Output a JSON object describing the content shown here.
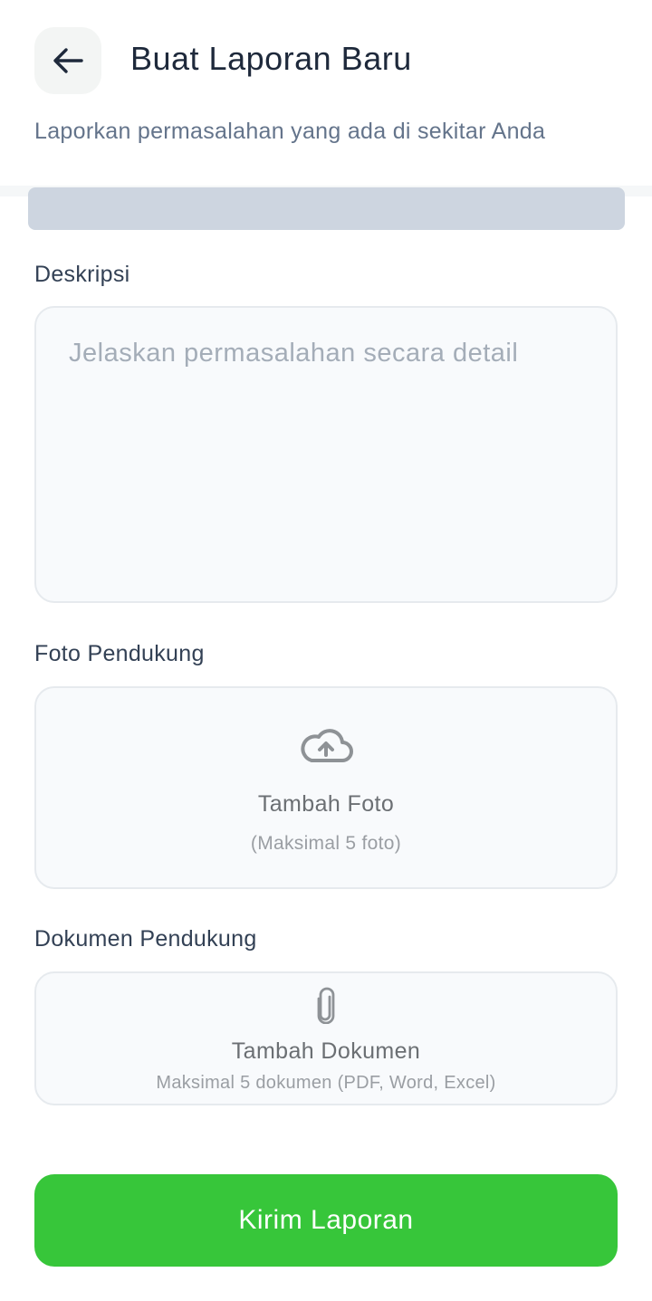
{
  "header": {
    "back_icon": "arrow-left-icon",
    "title": "Buat Laporan Baru",
    "subtitle": "Laporkan permasalahan yang ada di sekitar Anda"
  },
  "form": {
    "description": {
      "label": "Deskripsi",
      "placeholder": "Jelaskan permasalahan secara detail",
      "value": ""
    },
    "photos": {
      "label": "Foto Pendukung",
      "icon": "cloud-upload-icon",
      "action": "Tambah Foto",
      "hint": "(Maksimal 5 foto)"
    },
    "documents": {
      "label": "Dokumen Pendukung",
      "icon": "paperclip-icon",
      "action": "Tambah Dokumen",
      "hint": "Maksimal 5 dokumen (PDF, Word, Excel)"
    },
    "submit_label": "Kirim Laporan"
  },
  "colors": {
    "primary": "#37c63a",
    "title": "#1e293b",
    "subtitle": "#64748b",
    "field_bg": "#f8fafc",
    "field_border": "#e6eaee",
    "placeholder_bar": "#cdd5e0"
  }
}
